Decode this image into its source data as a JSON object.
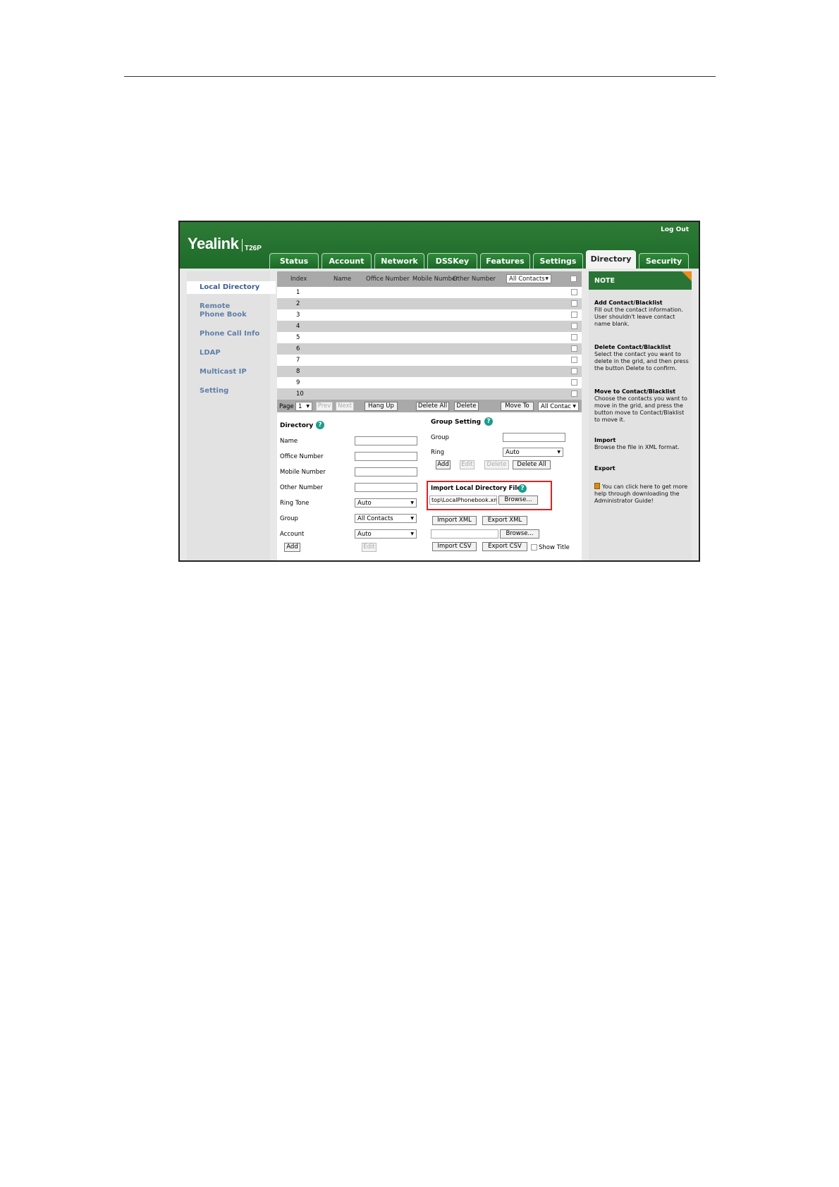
{
  "app": {
    "logo": "Yealink",
    "model": "T26P",
    "logout_label": "Log Out"
  },
  "tabs": [
    {
      "label": "Status"
    },
    {
      "label": "Account"
    },
    {
      "label": "Network"
    },
    {
      "label": "DSSKey"
    },
    {
      "label": "Features"
    },
    {
      "label": "Settings"
    },
    {
      "label": "Directory",
      "active": true
    },
    {
      "label": "Security"
    }
  ],
  "sidebar": {
    "items": [
      {
        "label": "Local Directory",
        "active": true
      },
      {
        "label": "Remote Phone Book"
      },
      {
        "label": "Phone Call Info"
      },
      {
        "label": "LDAP"
      },
      {
        "label": "Multicast IP"
      },
      {
        "label": "Setting"
      }
    ]
  },
  "grid": {
    "columns": {
      "index": "Index",
      "name": "Name",
      "office": "Office Number",
      "mobile": "Mobile Number",
      "other": "Other Number"
    },
    "filter_value": "All Contacts",
    "rows": [
      "1",
      "2",
      "3",
      "4",
      "5",
      "6",
      "7",
      "8",
      "9",
      "10"
    ]
  },
  "pager": {
    "page_label": "Page",
    "page_value": "1",
    "prev": "Prev",
    "next": "Next",
    "hang_up": "Hang Up",
    "delete_all": "Delete All",
    "delete": "Delete",
    "move_to": "Move To",
    "move_target": "All Contac"
  },
  "directory_form": {
    "title": "Directory",
    "name_label": "Name",
    "office_label": "Office Number",
    "mobile_label": "Mobile Number",
    "other_label": "Other Number",
    "ring_tone_label": "Ring Tone",
    "ring_tone_value": "Auto",
    "group_label": "Group",
    "group_value": "All Contacts",
    "account_label": "Account",
    "account_value": "Auto",
    "add": "Add",
    "edit": "Edit"
  },
  "group_setting": {
    "title": "Group Setting",
    "group_label": "Group",
    "ring_label": "Ring",
    "ring_value": "Auto",
    "add": "Add",
    "edit": "Edit",
    "delete": "Delete",
    "delete_all": "Delete All"
  },
  "import_section": {
    "title": "Import Local Directory File",
    "file_value": "top\\LocalPhonebook.xml",
    "browse": "Browse...",
    "import_xml": "Import XML",
    "export_xml": "Export XML",
    "browse2": "Browse...",
    "import_csv": "Import CSV",
    "export_csv": "Export CSV",
    "show_title": "Show Title"
  },
  "note": {
    "header": "NOTE",
    "add_title": "Add Contact/Blacklist",
    "add_body": "Fill out the contact information. User shouldn't leave contact name blank.",
    "delete_title": "Delete Contact/Blacklist",
    "delete_body": "Select the contact you want to delete in the grid, and then press the button Delete to confirm.",
    "move_title": "Move to Contact/Blacklist",
    "move_body": "Choose the contacts you want to move in the grid, and press the button move to Contact/Blaklist to move it.",
    "import_title": "Import",
    "import_body": "Browse the file in XML format.",
    "export_title": "Export",
    "help_text": "You can click here to get more help through downloading the Administrator Guide!"
  }
}
